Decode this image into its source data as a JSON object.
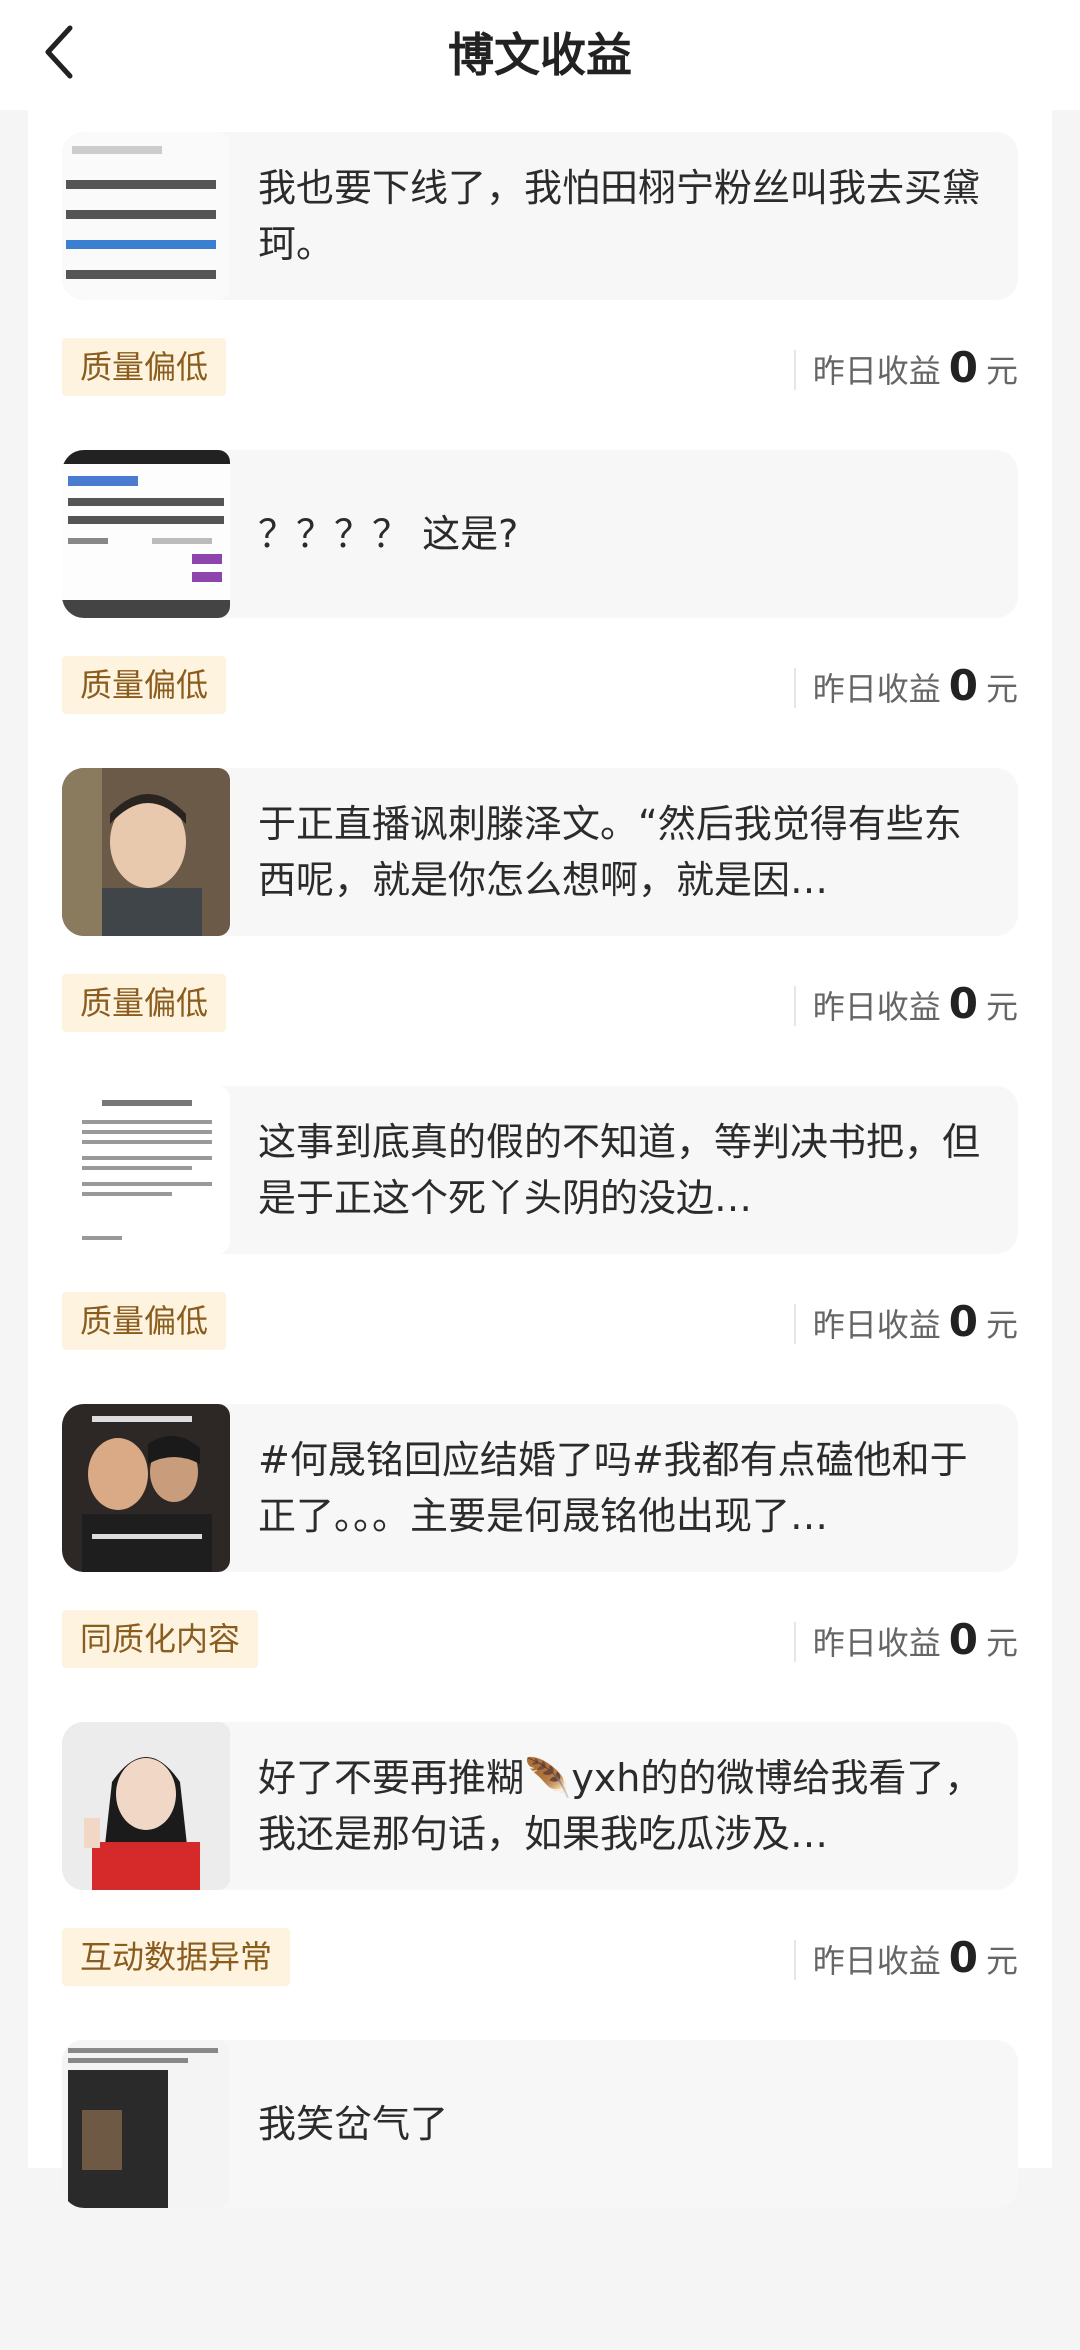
{
  "header": {
    "title": "博文收益"
  },
  "items": [
    {
      "text": "我也要下线了，我怕田栩宁粉丝叫我去买黛珂。",
      "tag": "质量偏低",
      "earn_label": "昨日收益",
      "earn_value": "0",
      "unit": "元"
    },
    {
      "text": "？？？？ 这是?",
      "tag": "质量偏低",
      "earn_label": "昨日收益",
      "earn_value": "0",
      "unit": "元"
    },
    {
      "text": "于正直播讽刺滕泽文。“然后我觉得有些东西呢，就是你怎么想啊，就是因…",
      "tag": "质量偏低",
      "earn_label": "昨日收益",
      "earn_value": "0",
      "unit": "元"
    },
    {
      "text": "这事到底真的假的不知道，等判决书把，但是于正这个死丫头阴的没边…",
      "tag": "质量偏低",
      "earn_label": "昨日收益",
      "earn_value": "0",
      "unit": "元"
    },
    {
      "text": "#何晟铭回应结婚了吗#我都有点磕他和于正了。。。主要是何晟铭他出现了…",
      "tag": "同质化内容",
      "earn_label": "昨日收益",
      "earn_value": "0",
      "unit": "元"
    },
    {
      "text": "好了不要再推糊🪶yxh的的微博给我看了，我还是那句话，如果我吃瓜涉及…",
      "tag": "互动数据异常",
      "earn_label": "昨日收益",
      "earn_value": "0",
      "unit": "元"
    },
    {
      "text": "我笑岔气了"
    }
  ]
}
